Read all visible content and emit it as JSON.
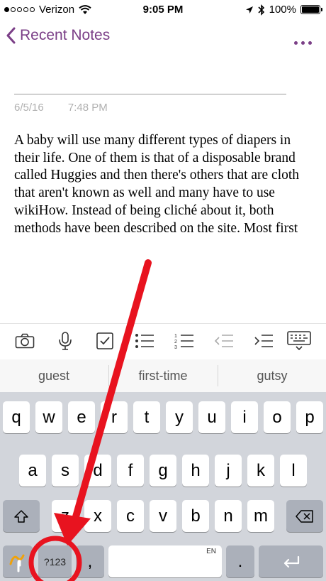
{
  "status_bar": {
    "carrier": "Verizon",
    "time": "9:05 PM",
    "battery": "100%"
  },
  "nav": {
    "back_label": "Recent Notes"
  },
  "note": {
    "date": "6/5/16",
    "time": "7:48 PM",
    "body": "A baby will use many different types of diapers in their life. One of them is that of a disposable brand called Huggies and then there's others that are cloth that aren't known as well and many have to use wikiHow. Instead of being cliché about it, both methods have been described on the site. Most first"
  },
  "suggestions": [
    "guest",
    "first-time",
    "gutsy"
  ],
  "keyboard": {
    "row1": [
      "q",
      "w",
      "e",
      "r",
      "t",
      "y",
      "u",
      "i",
      "o",
      "p"
    ],
    "row2": [
      "a",
      "s",
      "d",
      "f",
      "g",
      "h",
      "j",
      "k",
      "l"
    ],
    "row3": [
      "z",
      "x",
      "c",
      "v",
      "b",
      "n",
      "m"
    ],
    "numbers_key": "?123",
    "comma_key": ",",
    "period_key": ".",
    "space_lang": "EN"
  },
  "colors": {
    "accent": "#7b3f87",
    "annotation": "#e8131f"
  }
}
